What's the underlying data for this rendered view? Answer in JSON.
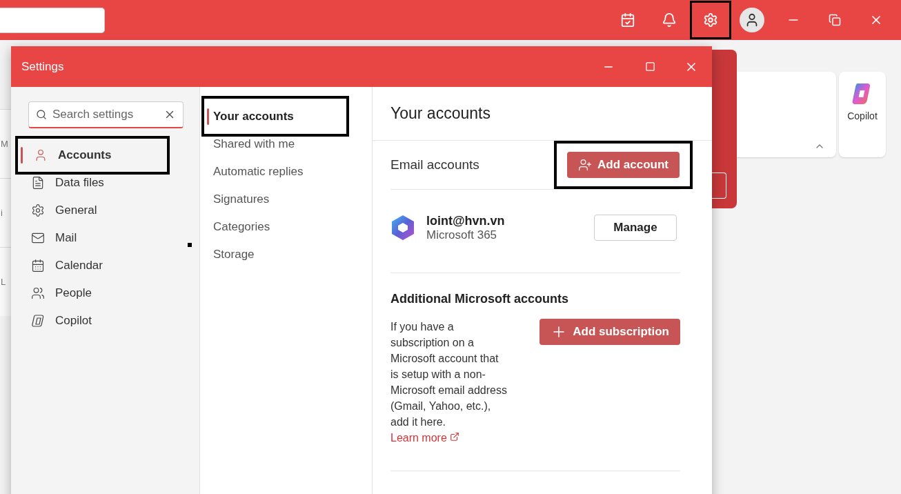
{
  "toolbar": {
    "settings_highlighted": true
  },
  "background": {
    "list_fragments": [
      "M",
      "i",
      "L"
    ],
    "copilot_card": {
      "label": "Copilot"
    }
  },
  "settings": {
    "title": "Settings",
    "search": {
      "placeholder": "Search settings"
    },
    "categories": [
      {
        "label": "Accounts",
        "selected": true,
        "highlighted": true
      },
      {
        "label": "Data files",
        "selected": false,
        "highlighted": false
      },
      {
        "label": "General",
        "selected": false,
        "highlighted": false
      },
      {
        "label": "Mail",
        "selected": false,
        "highlighted": false
      },
      {
        "label": "Calendar",
        "selected": false,
        "highlighted": false
      },
      {
        "label": "People",
        "selected": false,
        "highlighted": false
      },
      {
        "label": "Copilot",
        "selected": false,
        "highlighted": false
      }
    ],
    "subcategories": [
      {
        "label": "Your accounts",
        "selected": true,
        "highlighted": true
      },
      {
        "label": "Shared with me",
        "selected": false,
        "highlighted": false
      },
      {
        "label": "Automatic replies",
        "selected": false,
        "highlighted": false
      },
      {
        "label": "Signatures",
        "selected": false,
        "highlighted": false
      },
      {
        "label": "Categories",
        "selected": false,
        "highlighted": false
      },
      {
        "label": "Storage",
        "selected": false,
        "highlighted": false
      }
    ],
    "content": {
      "heading": "Your accounts",
      "email_section": {
        "title": "Email accounts",
        "add_button": {
          "label": "Add account",
          "highlighted": true
        }
      },
      "accounts": [
        {
          "email": "loint@hvn.vn",
          "type": "Microsoft 365",
          "button": "Manage"
        }
      ],
      "additional": {
        "title": "Additional Microsoft accounts",
        "text": "If you have a subscription on a Microsoft account that is setup with a non-Microsoft email address (Gmail, Yahoo, etc.), add it here.",
        "link": "Learn more",
        "button": "Add subscription"
      }
    }
  }
}
